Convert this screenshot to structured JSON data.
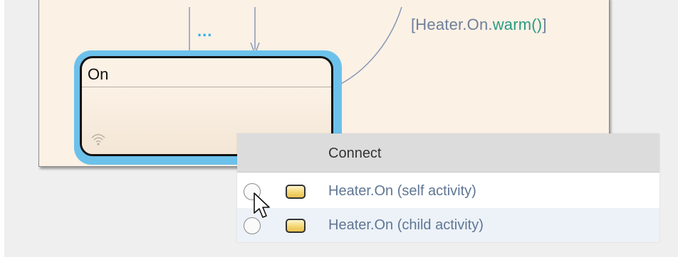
{
  "chart": {
    "guard": {
      "prefix": "[Heater.On.",
      "method": "warm()",
      "suffix": "]"
    },
    "ellipsis": "...",
    "state_name": "On"
  },
  "connect_popup": {
    "header": "Connect",
    "rows": [
      {
        "label": "Heater.On (self activity)",
        "selected": false
      },
      {
        "label": "Heater.On (child activity)",
        "selected": false
      }
    ]
  },
  "colors": {
    "chart_background": "#fbf1e5",
    "state_highlight": "#6cc1eb",
    "guard_text": "#6f7f9c",
    "guard_method": "#2a9a86",
    "row_text": "#5f7694"
  },
  "icons": {
    "state_activity": "wifi-icon",
    "row_state": "state-block-icon",
    "pointer": "mouse-cursor-icon"
  }
}
